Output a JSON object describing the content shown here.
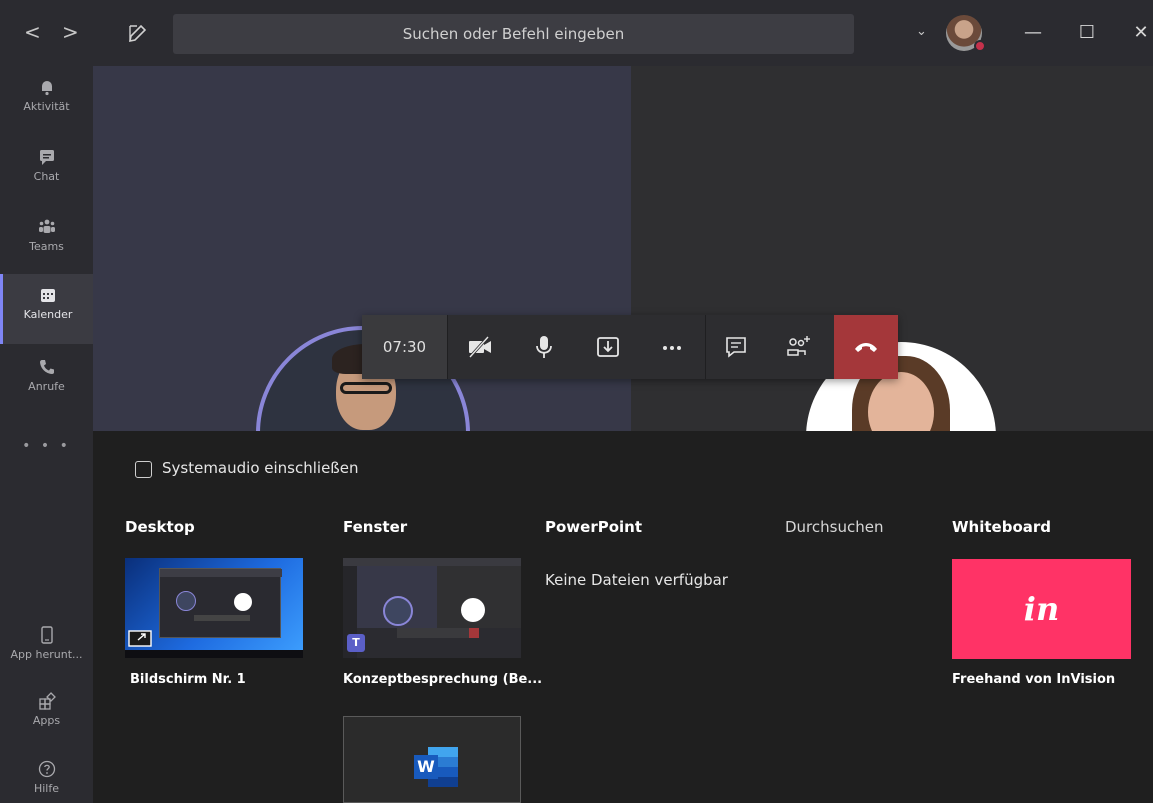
{
  "titlebar": {
    "search_placeholder": "Suchen oder Befehl eingeben",
    "back_glyph": "<",
    "forward_glyph": ">",
    "minimize_glyph": "—",
    "maximize_glyph": "☐",
    "close_glyph": "✕",
    "dropdown_glyph": "⌄"
  },
  "rail": {
    "items": [
      {
        "label": "Aktivität",
        "icon": "bell-icon"
      },
      {
        "label": "Chat",
        "icon": "chat-icon"
      },
      {
        "label": "Teams",
        "icon": "teams-icon"
      },
      {
        "label": "Kalender",
        "icon": "calendar-icon",
        "active": true
      },
      {
        "label": "Anrufe",
        "icon": "phone-icon"
      }
    ],
    "more": "• • •",
    "bottom": [
      {
        "label": "App herunt...",
        "icon": "device-icon"
      },
      {
        "label": "Apps",
        "icon": "apps-icon"
      },
      {
        "label": "Hilfe",
        "icon": "help-icon"
      }
    ]
  },
  "call": {
    "timer": "07:30",
    "buttons": [
      "camera-off-icon",
      "microphone-icon",
      "share-tray-icon",
      "more-icon",
      "chat-icon",
      "participants-icon",
      "hang-up-icon"
    ],
    "end_color": "#a4373a"
  },
  "share": {
    "system_audio_label": "Systemaudio einschließen",
    "columns": {
      "desktop": "Desktop",
      "window": "Fenster",
      "powerpoint": "PowerPoint",
      "browse": "Durchsuchen",
      "whiteboard": "Whiteboard"
    },
    "desktop_item": "Bildschirm Nr. 1",
    "window_item": "Konzeptbesprechung (Be...",
    "powerpoint_empty": "Keine Dateien verfügbar",
    "whiteboard_item": "Freehand von InVision",
    "whiteboard_logo": "in",
    "whiteboard_color": "#ff3366",
    "word_letter": "W"
  }
}
